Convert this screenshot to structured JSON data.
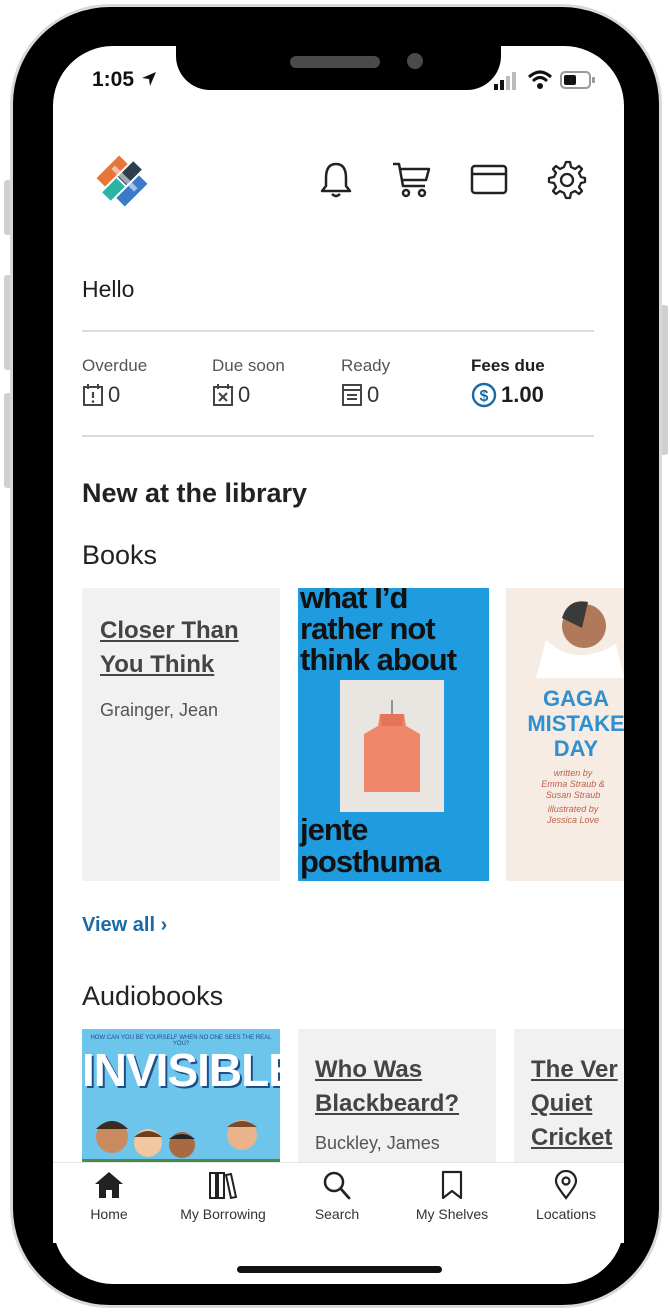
{
  "status_bar": {
    "time": "1:05"
  },
  "header": {
    "logo": "library-logo",
    "icons": [
      "bell-icon",
      "cart-icon",
      "card-icon",
      "gear-icon"
    ]
  },
  "greeting": "Hello",
  "stats": [
    {
      "label": "Overdue",
      "value": "0",
      "icon": "calendar-alert-icon"
    },
    {
      "label": "Due soon",
      "value": "0",
      "icon": "calendar-x-icon"
    },
    {
      "label": "Ready",
      "value": "0",
      "icon": "hold-shelf-icon"
    },
    {
      "label": "Fees due",
      "value": "1.00",
      "icon": "dollar-circle-icon"
    }
  ],
  "new_section": {
    "title": "New at the library",
    "books": {
      "heading": "Books",
      "items": [
        {
          "title_line1": "Closer Than",
          "title_line2": "You Think",
          "author": "Grainger, Jean"
        },
        {
          "cover_line1": "what I’d",
          "cover_line2": "rather not",
          "cover_line3": "think about",
          "cover_author1": "jente",
          "cover_author2": "posthuma"
        },
        {
          "cover_line1": "GAGA",
          "cover_line2": "MISTAKE",
          "cover_line3": "DAY",
          "cover_credit1": "written by",
          "cover_credit2": "Emma Straub &",
          "cover_credit3": "Susan Straub",
          "cover_credit4": "illustrated by",
          "cover_credit5": "Jessica Love"
        }
      ],
      "view_all": "View all ›"
    },
    "audiobooks": {
      "heading": "Audiobooks",
      "items": [
        {
          "cover_title": "INVISIBLE",
          "cover_tagline": "HOW CAN YOU BE YOURSELF WHEN NO ONE SEES THE REAL YOU?"
        },
        {
          "title_line1": "Who Was",
          "title_line2": "Blackbeard?",
          "author": "Buckley, James"
        },
        {
          "title_line1": "The Ver",
          "title_line2": "Quiet",
          "title_line3": "Cricket"
        }
      ]
    }
  },
  "bottom_nav": [
    {
      "label": "Home",
      "icon": "home-icon"
    },
    {
      "label": "My Borrowing",
      "icon": "books-icon"
    },
    {
      "label": "Search",
      "icon": "search-icon"
    },
    {
      "label": "My Shelves",
      "icon": "bookmark-icon"
    },
    {
      "label": "Locations",
      "icon": "location-pin-icon"
    }
  ],
  "colors": {
    "accent": "#1a6aa5",
    "cover_blue": "#1f9be0",
    "tile_bg": "#f1f1f1"
  }
}
